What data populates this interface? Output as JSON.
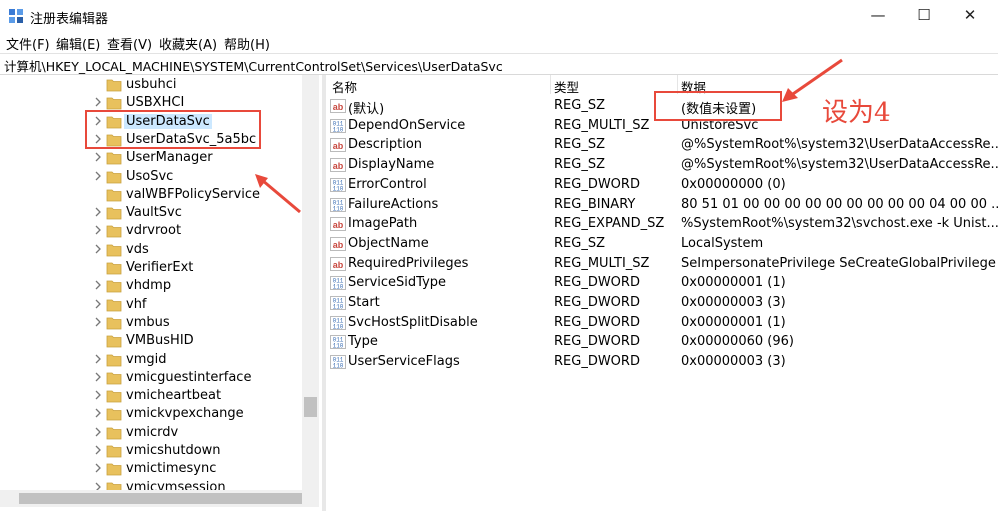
{
  "window": {
    "title": "注册表编辑器",
    "icon": "registry-editor-icon",
    "controls": [
      "minimize",
      "maximize",
      "close"
    ]
  },
  "menu": [
    "文件(F)",
    "编辑(E)",
    "查看(V)",
    "收藏夹(A)",
    "帮助(H)"
  ],
  "address": "计算机\\HKEY_LOCAL_MACHINE\\SYSTEM\\CurrentControlSet\\Services\\UserDataSvc",
  "tree": {
    "items": [
      {
        "label": "usbuhci",
        "expandable": false
      },
      {
        "label": "USBXHCI",
        "expandable": true
      },
      {
        "label": "UserDataSvc",
        "expandable": true,
        "selected": true
      },
      {
        "label": "UserDataSvc_5a5bc",
        "expandable": true
      },
      {
        "label": "UserManager",
        "expandable": true
      },
      {
        "label": "UsoSvc",
        "expandable": true
      },
      {
        "label": "valWBFPolicyService",
        "expandable": false
      },
      {
        "label": "VaultSvc",
        "expandable": true
      },
      {
        "label": "vdrvroot",
        "expandable": true
      },
      {
        "label": "vds",
        "expandable": true
      },
      {
        "label": "VerifierExt",
        "expandable": false
      },
      {
        "label": "vhdmp",
        "expandable": true
      },
      {
        "label": "vhf",
        "expandable": true
      },
      {
        "label": "vmbus",
        "expandable": true
      },
      {
        "label": "VMBusHID",
        "expandable": false
      },
      {
        "label": "vmgid",
        "expandable": true
      },
      {
        "label": "vmicguestinterface",
        "expandable": true
      },
      {
        "label": "vmicheartbeat",
        "expandable": true
      },
      {
        "label": "vmickvpexchange",
        "expandable": true
      },
      {
        "label": "vmicrdv",
        "expandable": true
      },
      {
        "label": "vmicshutdown",
        "expandable": true
      },
      {
        "label": "vmictimesync",
        "expandable": true
      },
      {
        "label": "vmicvmsession",
        "expandable": true
      }
    ]
  },
  "list": {
    "headers": {
      "name": "名称",
      "type": "类型",
      "data": "数据"
    },
    "rows": [
      {
        "icon": "ab",
        "name": "(默认)",
        "type": "REG_SZ",
        "data": "(数值未设置)"
      },
      {
        "icon": "bin",
        "name": "DependOnService",
        "type": "REG_MULTI_SZ",
        "data": "UnistoreSvc"
      },
      {
        "icon": "ab",
        "name": "Description",
        "type": "REG_SZ",
        "data": "@%SystemRoot%\\system32\\UserDataAccessRe..."
      },
      {
        "icon": "ab",
        "name": "DisplayName",
        "type": "REG_SZ",
        "data": "@%SystemRoot%\\system32\\UserDataAccessRe..."
      },
      {
        "icon": "bin",
        "name": "ErrorControl",
        "type": "REG_DWORD",
        "data": "0x00000000 (0)"
      },
      {
        "icon": "bin",
        "name": "FailureActions",
        "type": "REG_BINARY",
        "data": "80 51 01 00 00 00 00 00 00 00 00 00 04 00 00 ..."
      },
      {
        "icon": "ab",
        "name": "ImagePath",
        "type": "REG_EXPAND_SZ",
        "data": "%SystemRoot%\\system32\\svchost.exe -k Unist..."
      },
      {
        "icon": "ab",
        "name": "ObjectName",
        "type": "REG_SZ",
        "data": "LocalSystem"
      },
      {
        "icon": "ab",
        "name": "RequiredPrivileges",
        "type": "REG_MULTI_SZ",
        "data": "SeImpersonatePrivilege SeCreateGlobalPrivilege"
      },
      {
        "icon": "bin",
        "name": "ServiceSidType",
        "type": "REG_DWORD",
        "data": "0x00000001 (1)"
      },
      {
        "icon": "bin",
        "name": "Start",
        "type": "REG_DWORD",
        "data": "0x00000003 (3)"
      },
      {
        "icon": "bin",
        "name": "SvcHostSplitDisable",
        "type": "REG_DWORD",
        "data": "0x00000001 (1)"
      },
      {
        "icon": "bin",
        "name": "Type",
        "type": "REG_DWORD",
        "data": "0x00000060 (96)"
      },
      {
        "icon": "bin",
        "name": "UserServiceFlags",
        "type": "REG_DWORD",
        "data": "0x00000003 (3)"
      }
    ]
  },
  "annotation": {
    "text": "设为4",
    "color": "#e8493b"
  },
  "colors": {
    "folder": "#e8c15d",
    "selection_bg": "#cce8ff",
    "ab_icon": "#c8483f",
    "bin_icon": "#3c6fb5"
  }
}
